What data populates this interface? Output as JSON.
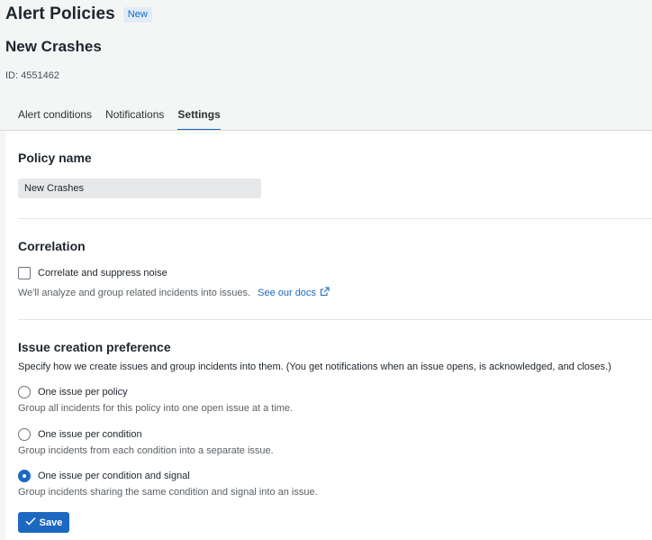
{
  "header": {
    "app_title": "Alert Policies",
    "badge": "New",
    "policy_title": "New Crashes",
    "policy_id": "ID: 4551462"
  },
  "tabs": [
    {
      "label": "Alert conditions",
      "active": false
    },
    {
      "label": "Notifications",
      "active": false
    },
    {
      "label": "Settings",
      "active": true
    }
  ],
  "policy_name": {
    "title": "Policy name",
    "value": "New Crashes"
  },
  "correlation": {
    "title": "Correlation",
    "checkbox_label": "Correlate and suppress noise",
    "checked": false,
    "help_text": "We'll analyze and group related incidents into issues.",
    "docs_link": "See our docs",
    "docs_icon": "external-link-icon"
  },
  "issue_creation": {
    "title": "Issue creation preference",
    "description": "Specify how we create issues and group incidents into them. (You get notifications when an issue opens, is acknowledged, and closes.)",
    "options": [
      {
        "label": "One issue per policy",
        "help": "Group all incidents for this policy into one open issue at a time.",
        "checked": false
      },
      {
        "label": "One issue per condition",
        "help": "Group incidents from each condition into a separate issue.",
        "checked": false
      },
      {
        "label": "One issue per condition and signal",
        "help": "Group incidents sharing the same condition and signal into an issue.",
        "checked": true
      }
    ]
  },
  "save_button": {
    "label": "Save",
    "icon": "checkmark-icon"
  },
  "colors": {
    "accent": "#1d68c1",
    "page_bg": "#f4f5f5",
    "panel_bg": "#ffffff",
    "badge_bg": "#e2ecf8"
  }
}
